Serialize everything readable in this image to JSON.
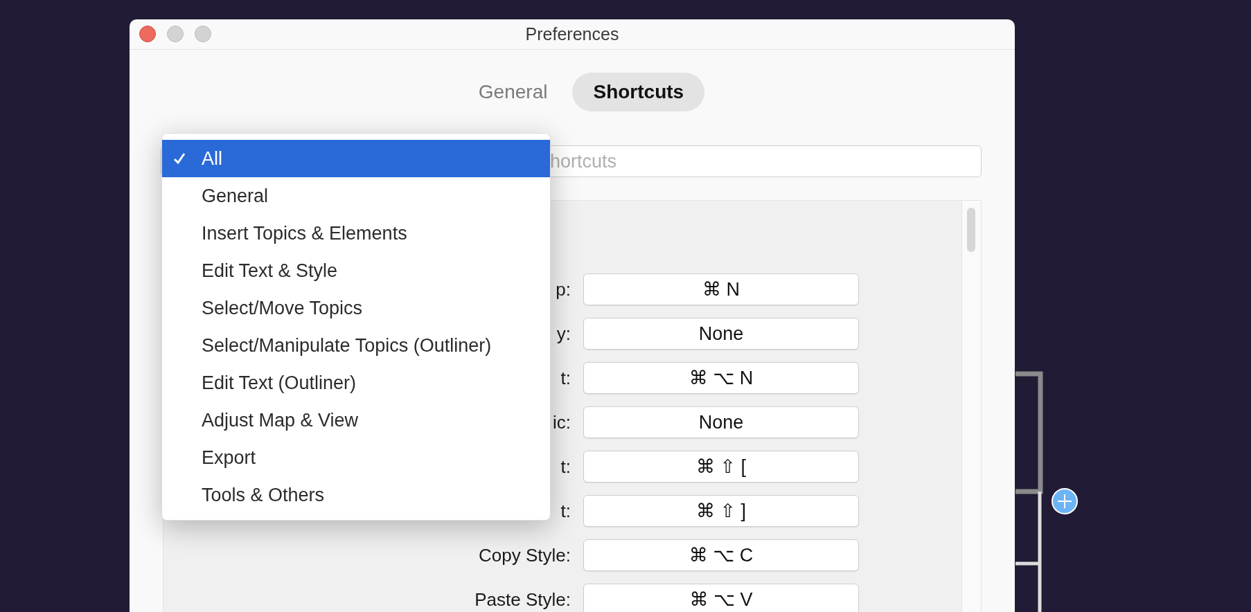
{
  "window": {
    "title": "Preferences"
  },
  "tabs": [
    {
      "label": "General",
      "selected": false
    },
    {
      "label": "Shortcuts",
      "selected": true
    }
  ],
  "search": {
    "placeholder": "hortcuts"
  },
  "shortcuts": [
    {
      "label": "p:",
      "keys": "⌘ N"
    },
    {
      "label": "y:",
      "keys": "None"
    },
    {
      "label": "t:",
      "keys": "⌘ ⌥ N"
    },
    {
      "label": "ic:",
      "keys": "None"
    },
    {
      "label": "t:",
      "keys": "⌘ ⇧ ["
    },
    {
      "label": "t:",
      "keys": "⌘ ⇧ ]"
    },
    {
      "label": "Copy Style:",
      "keys": "⌘ ⌥ C"
    },
    {
      "label": "Paste Style:",
      "keys": "⌘ ⌥ V"
    }
  ],
  "category_menu": {
    "items": [
      {
        "label": "All",
        "selected": true
      },
      {
        "label": "General",
        "selected": false
      },
      {
        "label": "Insert Topics & Elements",
        "selected": false
      },
      {
        "label": "Edit Text & Style",
        "selected": false
      },
      {
        "label": "Select/Move Topics",
        "selected": false
      },
      {
        "label": "Select/Manipulate Topics (Outliner)",
        "selected": false
      },
      {
        "label": "Edit Text (Outliner)",
        "selected": false
      },
      {
        "label": "Adjust Map & View",
        "selected": false
      },
      {
        "label": "Export",
        "selected": false
      },
      {
        "label": "Tools & Others",
        "selected": false
      }
    ]
  }
}
